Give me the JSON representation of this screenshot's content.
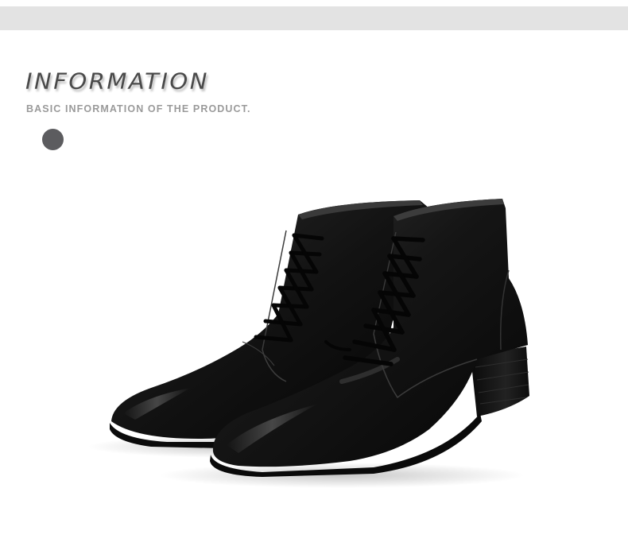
{
  "section": {
    "title": "INFORMATION",
    "subtitle": "BASIC INFORMATION OF THE PRODUCT."
  },
  "colors": {
    "band": "#e3e3e3",
    "title": "#4a4a4a",
    "subtitle": "#9a9a9a",
    "dot": "#5c5c5f",
    "leather": "#141414"
  },
  "product_image": {
    "icon": "black-leather-lace-up-ankle-boots-image"
  }
}
